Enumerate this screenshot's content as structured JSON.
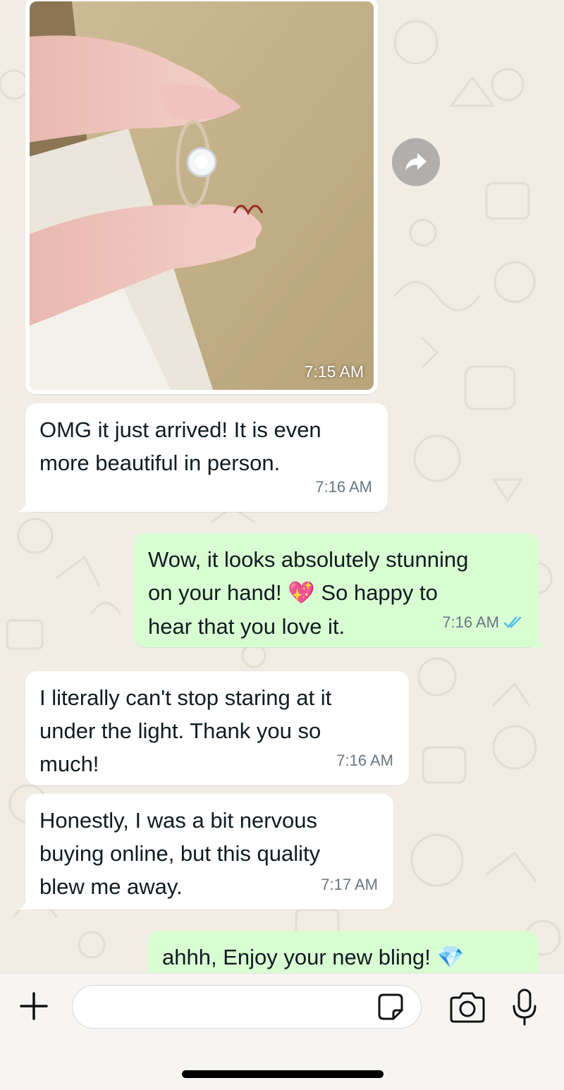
{
  "messages": [
    {
      "direction": "in",
      "type": "image",
      "time": "7:15 AM"
    },
    {
      "direction": "in",
      "type": "text",
      "text": "OMG it just arrived! It is even\nmore beautiful in person.",
      "time": "7:16 AM"
    },
    {
      "direction": "out",
      "type": "text",
      "text_a": "Wow, it looks absolutely stunning\non your hand! ",
      "emoji": "💖",
      "text_b": " So happy to\nhear that you love it.",
      "time": "7:16 AM",
      "status": "read"
    },
    {
      "direction": "in",
      "type": "text",
      "text": "I literally can't stop staring at it\nunder the light. Thank you so\nmuch!",
      "time": "7:16 AM"
    },
    {
      "direction": "in",
      "type": "text",
      "text": "Honestly, I was a bit nervous\nbuying online, but this quality\nblew me away.",
      "time": "7:17 AM"
    },
    {
      "direction": "out",
      "type": "text",
      "text": "ahhh,  Enjoy your new bling! ",
      "emoji": "💎"
    }
  ],
  "composer": {
    "placeholder": "",
    "value": ""
  },
  "icons": {
    "forward": "forward-arrow-icon",
    "plus": "plus-icon",
    "sticker": "sticker-icon",
    "camera": "camera-icon",
    "mic": "microphone-icon",
    "read_receipt": "double-check-icon"
  },
  "colors": {
    "chat_bg": "#f1ece4",
    "incoming": "#ffffff",
    "outgoing": "#d9fdd3",
    "read_check": "#53bdeb",
    "timestamp": "#667781"
  }
}
